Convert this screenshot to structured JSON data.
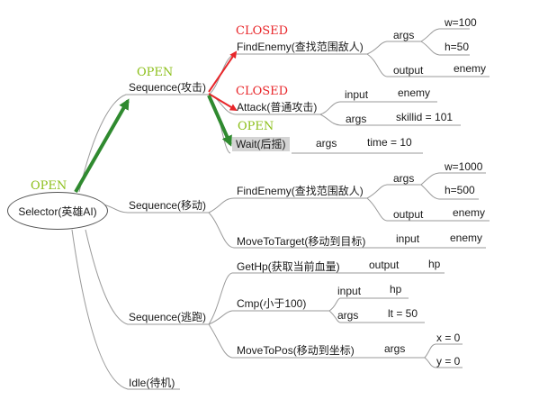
{
  "root": {
    "label": "Selector(英雄AI)",
    "state": "OPEN"
  },
  "branches": [
    {
      "label": "Sequence(攻击)",
      "state": "OPEN",
      "children": [
        {
          "label": "FindEnemy(查找范围敌人)",
          "state": "CLOSED",
          "params": [
            {
              "key": "args",
              "values": [
                "w=100",
                "h=50"
              ]
            },
            {
              "key": "output",
              "values": [
                "enemy"
              ]
            }
          ]
        },
        {
          "label": "Attack(普通攻击)",
          "state": "CLOSED",
          "params": [
            {
              "key": "input",
              "values": [
                "enemy"
              ]
            },
            {
              "key": "args",
              "values": [
                "skillid = 101"
              ]
            }
          ]
        },
        {
          "label": "Wait(后摇)",
          "state": "OPEN",
          "params": [
            {
              "key": "args",
              "values": [
                "time = 10"
              ]
            }
          ]
        }
      ]
    },
    {
      "label": "Sequence(移动)",
      "children": [
        {
          "label": "FindEnemy(查找范围敌人)",
          "params": [
            {
              "key": "args",
              "values": [
                "w=1000",
                "h=500"
              ]
            },
            {
              "key": "output",
              "values": [
                "enemy"
              ]
            }
          ]
        },
        {
          "label": "MoveToTarget(移动到目标)",
          "params": [
            {
              "key": "input",
              "values": [
                "enemy"
              ]
            }
          ]
        }
      ]
    },
    {
      "label": "Sequence(逃跑)",
      "children": [
        {
          "label": "GetHp(获取当前血量)",
          "params": [
            {
              "key": "output",
              "values": [
                "hp"
              ]
            }
          ]
        },
        {
          "label": "Cmp(小于100)",
          "params": [
            {
              "key": "input",
              "values": [
                "hp"
              ]
            },
            {
              "key": "args",
              "values": [
                "lt = 50"
              ]
            }
          ]
        },
        {
          "label": "MoveToPos(移动到坐标)",
          "params": [
            {
              "key": "args",
              "values": [
                "x = 0",
                "y = 0"
              ]
            }
          ]
        }
      ]
    },
    {
      "label": "Idle(待机)",
      "children": []
    }
  ],
  "colors": {
    "open": "#8cbf1a",
    "closed": "#e8262a",
    "line": "#9a9a9a",
    "open_arrow": "#2f8a2f",
    "closed_arrow": "#e8262a",
    "highlight": "#d4d4d4"
  }
}
